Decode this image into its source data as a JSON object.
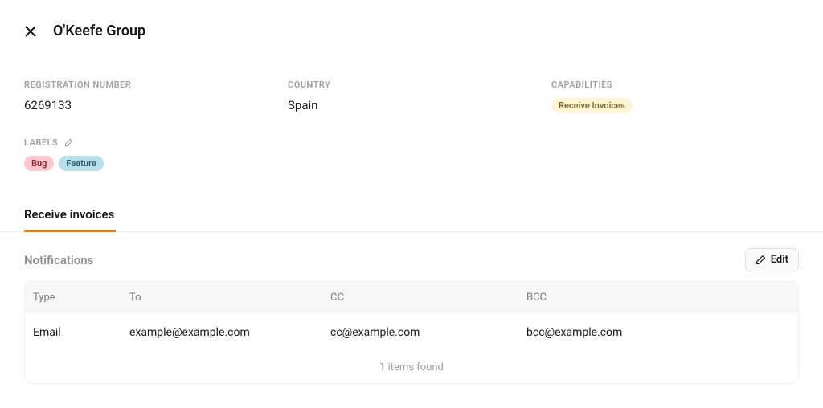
{
  "header": {
    "title": "O'Keefe Group"
  },
  "details": {
    "registration_label": "REGISTRATION NUMBER",
    "registration_value": "6269133",
    "country_label": "COUNTRY",
    "country_value": "Spain",
    "capabilities_label": "CAPABILITIES",
    "capabilities_badge": "Receive Invoices"
  },
  "labels": {
    "label": "LABELS",
    "items": [
      {
        "text": "Bug"
      },
      {
        "text": "Feature"
      }
    ]
  },
  "tabs": {
    "receive_invoices": "Receive invoices"
  },
  "notifications": {
    "title": "Notifications",
    "edit_label": "Edit",
    "headers": {
      "type": "Type",
      "to": "To",
      "cc": "CC",
      "bcc": "BCC"
    },
    "rows": [
      {
        "type": "Email",
        "to": "example@example.com",
        "cc": "cc@example.com",
        "bcc": "bcc@example.com"
      }
    ],
    "footer": "1 items found"
  }
}
